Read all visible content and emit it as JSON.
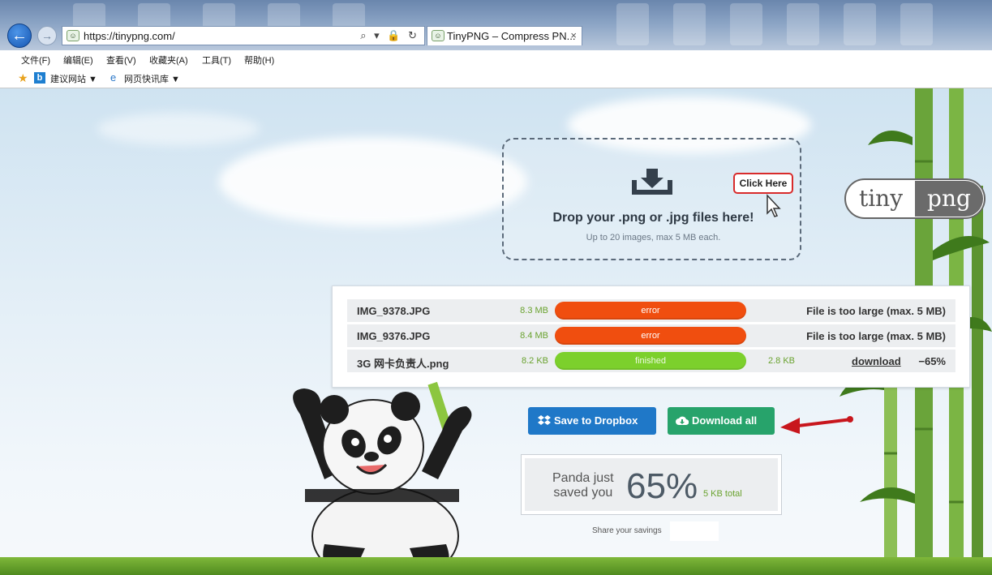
{
  "browser": {
    "url": "https://tinypng.com/",
    "tab_title": "TinyPNG – Compress PN...",
    "tab_close": "×",
    "address_tools": "⌕ ▾ 🔒 ↻",
    "menu": [
      "文件(F)",
      "编辑(E)",
      "查看(V)",
      "收藏夹(A)",
      "工具(T)",
      "帮助(H)"
    ],
    "favorites": [
      "建议网站 ▼",
      "网页快讯库 ▼"
    ],
    "back_icon": "arrow-left",
    "forward_icon": "arrow-right"
  },
  "dropzone": {
    "title": "Drop your .png or .jpg files here!",
    "subtitle": "Up to 20 images, max 5 MB each."
  },
  "callout": "Click Here",
  "logo": {
    "left": "tiny",
    "right": "png"
  },
  "results": [
    {
      "name": "IMG_9378.JPG",
      "size": "8.3 MB",
      "status": "error",
      "status_color": "#f04e0f",
      "message": "File is too large (max. 5 MB)"
    },
    {
      "name": "IMG_9376.JPG",
      "size": "8.4 MB",
      "status": "error",
      "status_color": "#f04e0f",
      "message": "File is too large (max. 5 MB)"
    },
    {
      "name": "3G 网卡负责人.png",
      "size": "8.2 KB",
      "status": "finished",
      "status_color": "#7cd02c",
      "new_size": "2.8 KB",
      "link": "download",
      "percent": "−65%"
    }
  ],
  "buttons": {
    "dropbox": "Save to Dropbox",
    "download_all": "Download all"
  },
  "savings": {
    "label_line1": "Panda just",
    "label_line2": "saved you",
    "percent": "65%",
    "total": "5 KB total"
  },
  "share": "Share your savings",
  "colors": {
    "error": "#f04e0f",
    "finished": "#7cd02c",
    "dropbox_blue": "#1f78c8",
    "download_green": "#27a36b",
    "size_green": "#69a22e"
  }
}
